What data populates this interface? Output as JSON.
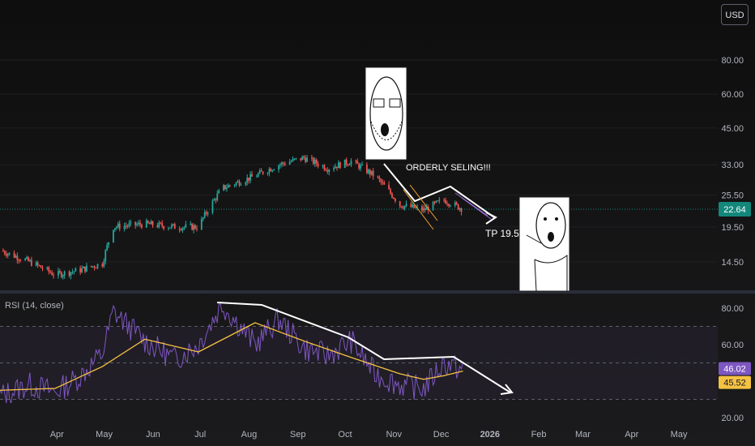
{
  "currency_button": "USD",
  "last_price_label": "22.64",
  "rsi_title": "RSI (14, close)",
  "rsi_value_label": "46.02",
  "rsi_ma_value_label": "45.52",
  "colors": {
    "background": "#121212",
    "up_candle": "#26a69a",
    "down_candle": "#ef5350",
    "rsi_line": "#7e57c2",
    "rsi_ma_line": "#f5c242",
    "last_price_badge": "#13877b",
    "rsi_badge": "#7e57c2",
    "rsi_ma_badge": "#f5c242",
    "drawing": "#ffffff"
  },
  "annotations": {
    "orderly_selling": "ORDERLY SELING!!!",
    "tp": "TP 19.5"
  },
  "chart_data": [
    {
      "type": "candlestick",
      "title": "",
      "y_scale": "log",
      "y_ticks": [
        "80.00",
        "60.00",
        "45.00",
        "33.00",
        "25.50",
        "19.50",
        "14.50"
      ],
      "x_ticks": [
        "Apr",
        "May",
        "Jun",
        "Jul",
        "Aug",
        "Sep",
        "Oct",
        "Nov",
        "Dec",
        "2026",
        "Feb",
        "Mar",
        "Apr",
        "May"
      ],
      "last_price": 22.64,
      "price_path": [
        {
          "x": "2025-03-01",
          "y": 16.0
        },
        {
          "x": "2025-03-20",
          "y": 14.5
        },
        {
          "x": "2025-04-05",
          "y": 13.0
        },
        {
          "x": "2025-04-20",
          "y": 13.5
        },
        {
          "x": "2025-05-05",
          "y": 14.3
        },
        {
          "x": "2025-05-12",
          "y": 19.5
        },
        {
          "x": "2025-06-01",
          "y": 20.0
        },
        {
          "x": "2025-06-20",
          "y": 19.5
        },
        {
          "x": "2025-07-05",
          "y": 19.5
        },
        {
          "x": "2025-07-20",
          "y": 27.0
        },
        {
          "x": "2025-08-10",
          "y": 30.0
        },
        {
          "x": "2025-08-25",
          "y": 33.0
        },
        {
          "x": "2025-09-10",
          "y": 35.0
        },
        {
          "x": "2025-09-25",
          "y": 32.0
        },
        {
          "x": "2025-10-10",
          "y": 34.0
        },
        {
          "x": "2025-10-25",
          "y": 30.0
        },
        {
          "x": "2025-11-10",
          "y": 23.5
        },
        {
          "x": "2025-11-25",
          "y": 22.5
        },
        {
          "x": "2025-12-08",
          "y": 24.5
        },
        {
          "x": "2025-12-20",
          "y": 22.64
        }
      ]
    },
    {
      "type": "line",
      "title": "RSI (14, close)",
      "y_ticks": [
        "80.00",
        "60.00",
        "20.00"
      ],
      "bands": [
        70,
        50,
        30
      ],
      "series": [
        {
          "name": "RSI",
          "last": 46.02,
          "values": [
            {
              "x": "2025-03-01",
              "y": 32
            },
            {
              "x": "2025-03-20",
              "y": 38
            },
            {
              "x": "2025-04-05",
              "y": 34
            },
            {
              "x": "2025-04-20",
              "y": 42
            },
            {
              "x": "2025-05-05",
              "y": 55
            },
            {
              "x": "2025-05-12",
              "y": 78
            },
            {
              "x": "2025-06-01",
              "y": 62
            },
            {
              "x": "2025-06-20",
              "y": 52
            },
            {
              "x": "2025-07-05",
              "y": 60
            },
            {
              "x": "2025-07-20",
              "y": 82
            },
            {
              "x": "2025-08-10",
              "y": 60
            },
            {
              "x": "2025-08-25",
              "y": 74
            },
            {
              "x": "2025-09-10",
              "y": 58
            },
            {
              "x": "2025-09-25",
              "y": 54
            },
            {
              "x": "2025-10-10",
              "y": 62
            },
            {
              "x": "2025-10-25",
              "y": 44
            },
            {
              "x": "2025-11-10",
              "y": 38
            },
            {
              "x": "2025-11-25",
              "y": 36
            },
            {
              "x": "2025-12-08",
              "y": 50
            },
            {
              "x": "2025-12-20",
              "y": 46.02
            }
          ]
        },
        {
          "name": "RSI-based MA",
          "last": 45.52,
          "values": [
            {
              "x": "2025-03-01",
              "y": 35
            },
            {
              "x": "2025-04-05",
              "y": 36
            },
            {
              "x": "2025-05-05",
              "y": 48
            },
            {
              "x": "2025-06-01",
              "y": 63
            },
            {
              "x": "2025-07-05",
              "y": 56
            },
            {
              "x": "2025-08-10",
              "y": 72
            },
            {
              "x": "2025-09-10",
              "y": 62
            },
            {
              "x": "2025-10-10",
              "y": 53
            },
            {
              "x": "2025-11-10",
              "y": 44
            },
            {
              "x": "2025-11-25",
              "y": 41
            },
            {
              "x": "2025-12-08",
              "y": 43
            },
            {
              "x": "2025-12-20",
              "y": 45.52
            }
          ]
        }
      ]
    }
  ]
}
